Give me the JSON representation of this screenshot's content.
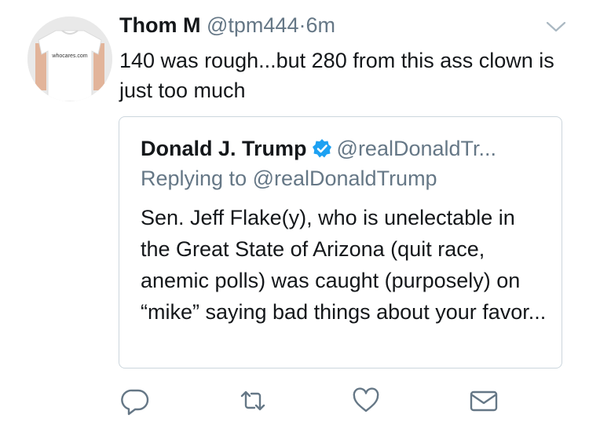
{
  "tweet": {
    "author_name": "Thom M",
    "author_handle": "@tpm444",
    "separator": "·",
    "timestamp": "6m",
    "avatar_shirt_text": "whocares.com",
    "text": "140 was rough...but 280 from this ass clown is just too much"
  },
  "quoted_tweet": {
    "author_name": "Donald J. Trump",
    "author_handle": "@realDonaldTr...",
    "replying_to": "Replying to @realDonaldTrump",
    "text": "Sen. Jeff Flake(y), who is unelectable in the Great State of Arizona (quit race, anemic polls) was caught (purposely) on “mike” saying bad things about your favor..."
  },
  "icons": {
    "caret": "chevron-down-icon",
    "verified": "verified-badge-icon",
    "reply": "reply-icon",
    "retweet": "retweet-icon",
    "like": "heart-icon",
    "message": "envelope-icon"
  },
  "colors": {
    "text": "#14171a",
    "muted": "#657786",
    "verified": "#1da1f2",
    "border": "#ccd6dd"
  }
}
